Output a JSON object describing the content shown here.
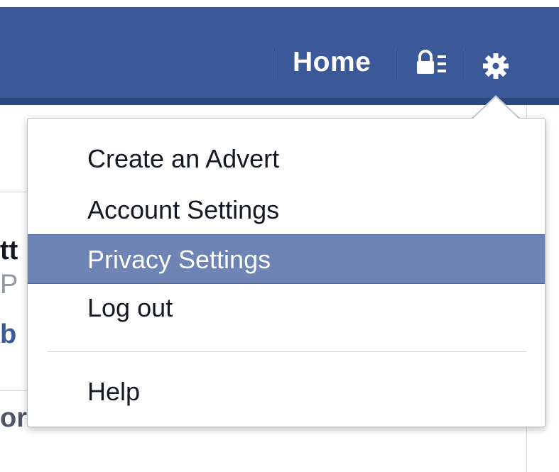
{
  "topbar": {
    "home_label": "Home",
    "privacy_shortcut_icon": "lock-list-icon",
    "settings_icon": "gear-icon",
    "background_color": "#3b5998"
  },
  "background_page": {
    "left_fragments": [
      "tt",
      "P",
      "b",
      "or"
    ]
  },
  "dropdown": {
    "items": [
      {
        "label": "Create an Advert"
      },
      {
        "label": "Account Settings"
      },
      {
        "label": "Privacy Settings",
        "highlighted": true
      },
      {
        "label": "Log out"
      },
      {
        "label": "Help"
      }
    ],
    "highlight_color": "#6d84b4"
  }
}
